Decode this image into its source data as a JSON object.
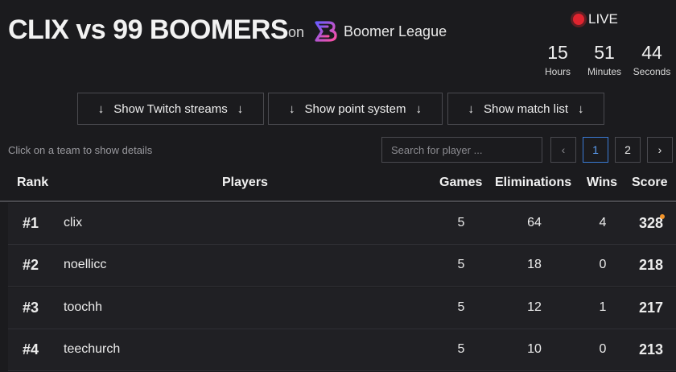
{
  "header": {
    "title": "CLIX vs 99 BOOMERS",
    "on": "on",
    "league": "Boomer League",
    "live": "LIVE",
    "countdown": [
      {
        "value": "15",
        "label": "Hours"
      },
      {
        "value": "51",
        "label": "Minutes"
      },
      {
        "value": "44",
        "label": "Seconds"
      }
    ]
  },
  "toggles": [
    {
      "label": "Show Twitch streams"
    },
    {
      "label": "Show point system"
    },
    {
      "label": "Show match list"
    }
  ],
  "hint": "Click on a team to show details",
  "search": {
    "placeholder": "Search for player ..."
  },
  "pagination": {
    "prev": "‹",
    "pages": [
      "1",
      "2"
    ],
    "current": "1",
    "next": "›"
  },
  "table": {
    "headers": {
      "rank": "Rank",
      "players": "Players",
      "games": "Games",
      "eliminations": "Eliminations",
      "wins": "Wins",
      "score": "Score"
    },
    "rows": [
      {
        "rank": "#1",
        "player": "clix",
        "games": "5",
        "eliminations": "64",
        "wins": "4",
        "score": "328"
      },
      {
        "rank": "#2",
        "player": "noellicc",
        "games": "5",
        "eliminations": "18",
        "wins": "0",
        "score": "218"
      },
      {
        "rank": "#3",
        "player": "toochh",
        "games": "5",
        "eliminations": "12",
        "wins": "1",
        "score": "217"
      },
      {
        "rank": "#4",
        "player": "teechurch",
        "games": "5",
        "eliminations": "10",
        "wins": "0",
        "score": "213"
      }
    ]
  },
  "colors": {
    "live": "#e0242f",
    "accent": "#3a7bd5",
    "score_dot": "#f2942a",
    "logo_a": "#6a5cff",
    "logo_b": "#ff4fa3"
  }
}
